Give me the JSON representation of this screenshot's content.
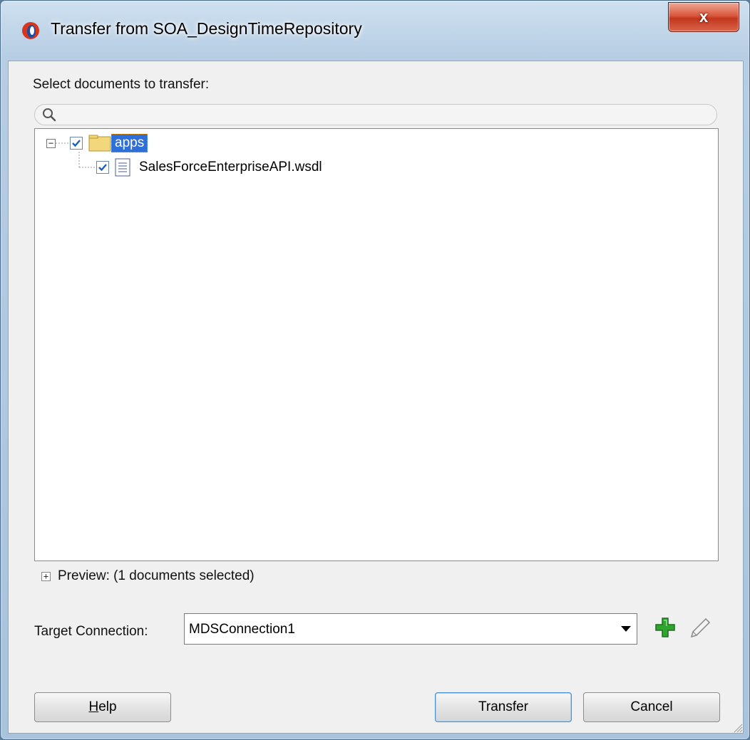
{
  "window": {
    "title": "Transfer from SOA_DesignTimeRepository",
    "close_label": "x"
  },
  "dialog": {
    "select_label": "Select documents to transfer:",
    "search": {
      "value": "",
      "placeholder": ""
    },
    "tree": [
      {
        "label": "apps",
        "checked": true,
        "type": "folder",
        "expanded": true,
        "selected": true
      },
      {
        "label": "SalesForceEnterpriseAPI.wsdl",
        "checked": true,
        "type": "document",
        "selected": false
      }
    ],
    "preview": {
      "expander": "+",
      "label": "Preview: (1 documents selected)"
    },
    "target": {
      "label": "Target Connection:",
      "value": "MDSConnection1"
    },
    "buttons": {
      "help_pre": "",
      "help_mnemonic": "H",
      "help_post": "elp",
      "transfer": "Transfer",
      "cancel": "Cancel"
    }
  },
  "colors": {
    "selection": "#2f6fd8",
    "accent_green": "#2fa52f",
    "checkmark": "#1d5fb8"
  }
}
